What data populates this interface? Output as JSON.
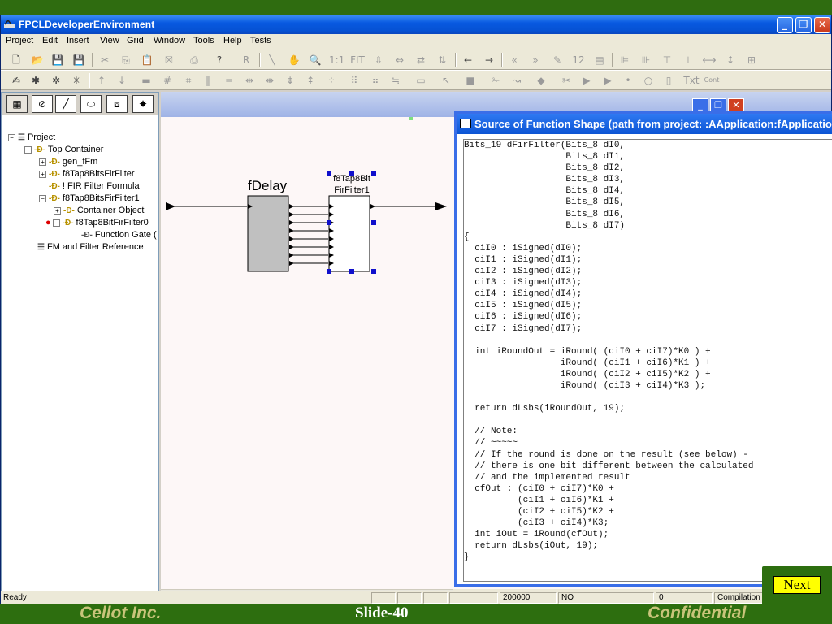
{
  "window": {
    "title": "FPCLDeveloperEnvironment",
    "minimize": "_",
    "restore": "❐",
    "close": "✕"
  },
  "menu": [
    "Project",
    "Edit",
    "Insert",
    "View",
    "Grid",
    "Window",
    "Tools",
    "Help",
    "Tests"
  ],
  "toolbar1_text": {
    "r_label": "R",
    "one_to_one": "1:1",
    "fit": "FIT",
    "twelve": "12"
  },
  "toolbar2_text": {
    "txt": "Txt",
    "cont": "Cont"
  },
  "tree": {
    "items": [
      "Project",
      "Top Container",
      "gen_fFm",
      "f8Tap8BitsFirFilter",
      "! FIR Filter Formula",
      "f8Tap8BitsFirFilter1",
      "Container Object",
      "f8Tap8BitFirFilter0",
      "Function Gate (",
      "FM and Filter Reference"
    ]
  },
  "diagram": {
    "delay_label": "fDelay",
    "filter_label_line1": "f8Tap8Bit",
    "filter_label_line2": "FirFilter1"
  },
  "code_window": {
    "title": "Source of Function Shape (path from project: :AApplication:fApplicatio",
    "code": "Bits_19 dFirFilter(Bits_8 dI0,\n                   Bits_8 dI1,\n                   Bits_8 dI2,\n                   Bits_8 dI3,\n                   Bits_8 dI4,\n                   Bits_8 dI5,\n                   Bits_8 dI6,\n                   Bits_8 dI7)\n{\n  ciI0 : iSigned(dI0);\n  ciI1 : iSigned(dI1);\n  ciI2 : iSigned(dI2);\n  ciI3 : iSigned(dI3);\n  ciI4 : iSigned(dI4);\n  ciI5 : iSigned(dI5);\n  ciI6 : iSigned(dI6);\n  ciI7 : iSigned(dI7);\n\n  int iRoundOut = iRound( (ciI0 + ciI7)*K0 ) +\n                  iRound( (ciI1 + ciI6)*K1 ) +\n                  iRound( (ciI2 + ciI5)*K2 ) +\n                  iRound( (ciI3 + ciI4)*K3 );\n\n  return dLsbs(iRoundOut, 19);\n\n  // Note:\n  // ~~~~~\n  // If the round is done on the result (see below) -\n  // there is one bit different between the calculated\n  // and the implemented result\n  cfOut : (ciI0 + ciI7)*K0 +\n          (ciI1 + ciI6)*K1 +\n          (ciI2 + ciI5)*K2 +\n          (ciI3 + ciI4)*K3;\n  int iOut = iRound(cfOut);\n  return dLsbs(iOut, 19);\n}"
  },
  "status": {
    "ready": "Ready",
    "value1": "200000",
    "value2": "NO",
    "value3": "0",
    "value4": "Compilation"
  },
  "footer": {
    "left": "Cellot Inc.",
    "center": "Slide-40",
    "right": "Confidential"
  },
  "next_label": "Next"
}
